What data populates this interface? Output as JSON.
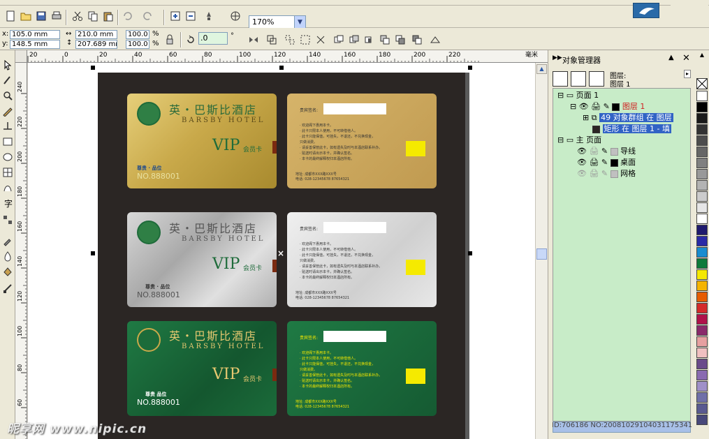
{
  "toolbar": {
    "zoom_value": "170%"
  },
  "property_bar": {
    "x_label": "x:",
    "x_value": "105.0 mm",
    "y_label": "y:",
    "y_value": "148.5 mm",
    "width_value": "210.0 mm",
    "height_value": "207.689 mr",
    "scale_x": "100.0",
    "scale_y": "100.0",
    "percent": "%",
    "rotation_value": ".0",
    "degree": "°"
  },
  "ruler": {
    "h_ticks": [
      "20",
      "0",
      "20",
      "40",
      "60",
      "80",
      "100",
      "120",
      "140",
      "160",
      "180",
      "200",
      "220"
    ],
    "h_unit": "毫米",
    "v_ticks": [
      "240",
      "220",
      "200",
      "180",
      "160",
      "140",
      "120",
      "100",
      "80",
      "60"
    ]
  },
  "object_manager": {
    "title": "对象管理器",
    "layer_label_1": "图层:",
    "layer_label_2": "图层 1",
    "tree": [
      {
        "label": "页面 1"
      },
      {
        "label": "图层 1"
      },
      {
        "label": "49 对象群组 在 图层"
      },
      {
        "label": "矩形 在 图层 1 - 填"
      },
      {
        "label": "主 页面"
      },
      {
        "label": "导线"
      },
      {
        "label": "桌面"
      },
      {
        "label": "网格"
      }
    ]
  },
  "cards": {
    "title": "英・巴斯比酒店",
    "subtitle": "BARSBY HOTEL",
    "vip": "VIP",
    "vip_sub": "会员卡",
    "grade_gold": "尊贵 · 品位",
    "grade_silver": "尊贵 · 品位",
    "grade_green": "尊贵   品位",
    "card_no_gold": "NO.888001",
    "card_no_silver": "NO.888001",
    "card_no_green": "NO.888001",
    "back_signature": "贵宾签名:",
    "back_lines": [
      "· 欢迎阁下惠用本卡。",
      "· 此卡只限本人使用，不可转借他人。",
      "· 此卡只能保值，可挂失，不退还，不兑换现金，",
      "  只做消费。",
      "· 请妥善保管此卡，如有遗失及时与本酒店联系补办。",
      "· 贴送时请出示本卡，并确认签名。",
      "· 本卡的最终解释权归本酒店所有。"
    ],
    "back_address": "地址: 成都市XXX路XXX号",
    "back_phone": "电话: 028-12345678    87654321"
  },
  "watermark": "昵享网 www.nipic.cn",
  "status_text": "ID:706186 NO:20081029104031175341",
  "palette_colors": [
    "#ffffff",
    "#000000",
    "#1a1a1a",
    "#333333",
    "#4d4d4d",
    "#666666",
    "#808080",
    "#999999",
    "#b3b3b3",
    "#cccccc",
    "#e6e6e6",
    "#ffffff",
    "#1f1a6e",
    "#2a2aa6",
    "#1a8ccf",
    "#0e7a3a",
    "#f5e800",
    "#f5b400",
    "#e65c00",
    "#d42a2a",
    "#b0124a",
    "#8a2a6a",
    "#e6a0a0",
    "#f0c0c0",
    "#6a4a8a",
    "#8a6ab0",
    "#a090c8",
    "#7070a8",
    "#5a5a90",
    "#48487a"
  ],
  "colors": {
    "gold": "#c9a94a",
    "green": "#1b6b3a",
    "selection": "#3163c5",
    "docker_bg": "#c8ecc8"
  }
}
